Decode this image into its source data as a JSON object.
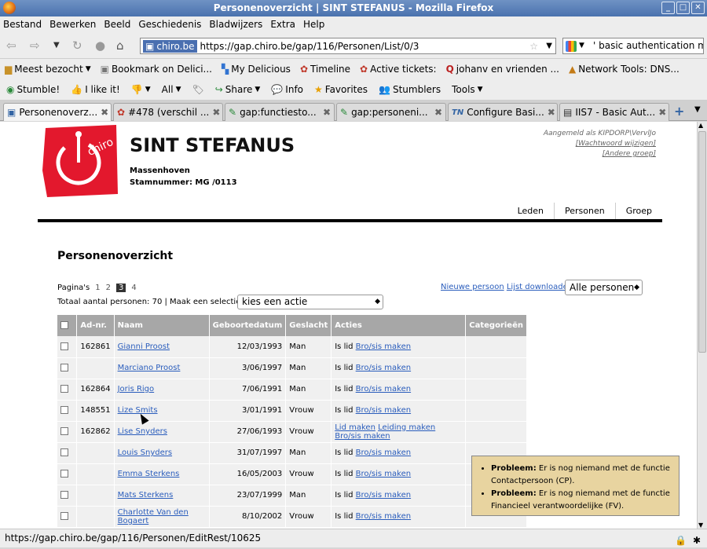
{
  "window": {
    "title": "Personenoverzicht | SINT STEFANUS - Mozilla Firefox"
  },
  "menu": [
    "Bestand",
    "Bewerken",
    "Beeld",
    "Geschiedenis",
    "Bladwijzers",
    "Extra",
    "Help"
  ],
  "nav": {
    "site": "chiro.be",
    "url": "https://gap.chiro.be/gap/116/Personen/List/0/3",
    "search": "' basic authentication m"
  },
  "bookmarks": [
    "Meest bezocht",
    "Bookmark on Delici...",
    "My Delicious",
    "Timeline",
    "Active tickets:",
    "johanv en vrienden ...",
    "Network Tools: DNS..."
  ],
  "toolbar2": [
    "Stumble!",
    "I like it!",
    "All",
    "Share",
    "Info",
    "Favorites",
    "Stumblers",
    "Tools"
  ],
  "tabs": [
    "Personenoverz...",
    "#478 (verschil ...",
    "gap:functiesto...",
    "gap:personeni...",
    "Configure Basi...",
    "IIS7 - Basic Aut..."
  ],
  "site": {
    "title": "SINT STEFANUS",
    "place": "Massenhoven",
    "stamnummer": "Stamnummer: MG /0113",
    "logo_text": "chiro",
    "login": "Aangemeld als KIPDORP\\VervlJo",
    "change_pw": "[Wachtwoord wijzigen]",
    "other_group": "[Andere groep]",
    "mainnav": [
      "Leden",
      "Personen",
      "Groep"
    ]
  },
  "page": {
    "title": "Personenoverzicht",
    "pages_label": "Pagina's",
    "pages": [
      "1",
      "2",
      "3",
      "4"
    ],
    "total": "Totaal aantal personen: 70 | Maak een selectie en",
    "action_select": "kies een actie",
    "new_person": "Nieuwe persoon",
    "download": "Lijst downloaden",
    "filter": "Alle personen"
  },
  "table": {
    "headers": [
      "",
      "Ad-nr.",
      "Naam",
      "Geboortedatum",
      "Geslacht",
      "Acties",
      "Categorieën"
    ],
    "rows": [
      {
        "adnr": "162861",
        "naam": "Gianni Proost",
        "geb": "12/03/1993",
        "gesl": "Man",
        "pre": "Is lid",
        "links": [
          "Bro/sis maken"
        ]
      },
      {
        "adnr": "",
        "naam": "Marciano Proost",
        "geb": "3/06/1997",
        "gesl": "Man",
        "pre": "Is lid",
        "links": [
          "Bro/sis maken"
        ]
      },
      {
        "adnr": "162864",
        "naam": "Joris Rigo",
        "geb": "7/06/1991",
        "gesl": "Man",
        "pre": "Is lid",
        "links": [
          "Bro/sis maken"
        ]
      },
      {
        "adnr": "148551",
        "naam": "Lize Smits",
        "geb": "3/01/1991",
        "gesl": "Vrouw",
        "pre": "Is lid",
        "links": [
          "Bro/sis maken"
        ]
      },
      {
        "adnr": "162862",
        "naam": "Lise Snyders",
        "geb": "27/06/1993",
        "gesl": "Vrouw",
        "pre": "",
        "links": [
          "Lid maken",
          "Leiding maken",
          "Bro/sis maken"
        ]
      },
      {
        "adnr": "",
        "naam": "Louis Snyders",
        "geb": "31/07/1997",
        "gesl": "Man",
        "pre": "Is lid",
        "links": [
          "Bro/sis maken"
        ]
      },
      {
        "adnr": "",
        "naam": "Emma Sterkens",
        "geb": "16/05/2003",
        "gesl": "Vrouw",
        "pre": "Is lid",
        "links": [
          "Bro/sis maken"
        ]
      },
      {
        "adnr": "",
        "naam": "Mats Sterkens",
        "geb": "23/07/1999",
        "gesl": "Man",
        "pre": "Is lid",
        "links": [
          "Bro/sis maken"
        ]
      },
      {
        "adnr": "",
        "naam": "Charlotte Van den Bogaert",
        "geb": "8/10/2002",
        "gesl": "Vrouw",
        "pre": "Is lid",
        "links": [
          "Bro/sis maken"
        ]
      }
    ]
  },
  "problems": [
    {
      "label": "Probleem:",
      "text": " Er is nog niemand met de functie Contactpersoon (CP)."
    },
    {
      "label": "Probleem:",
      "text": " Er is nog niemand met de functie Financieel verantwoordelijke (FV)."
    }
  ],
  "status": {
    "text": "https://gap.chiro.be/gap/116/Personen/EditRest/10625"
  }
}
